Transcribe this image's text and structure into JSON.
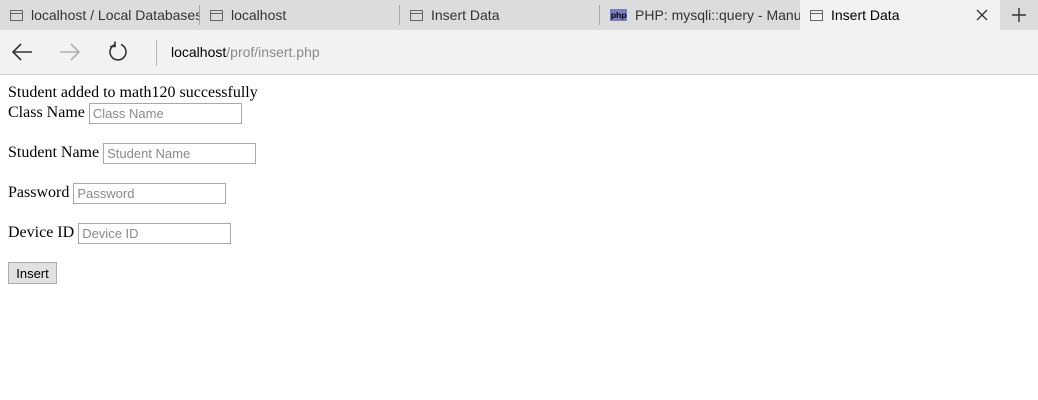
{
  "browser": {
    "tabs": [
      {
        "label": "localhost / Local Databases",
        "icon": "page-icon"
      },
      {
        "label": "localhost",
        "icon": "page-icon"
      },
      {
        "label": "Insert Data",
        "icon": "page-icon"
      },
      {
        "label": "PHP: mysqli::query - Manua",
        "icon": "php-icon",
        "icon_text": "php"
      },
      {
        "label": "Insert Data",
        "icon": "page-icon",
        "active": true
      }
    ],
    "address_host": "localhost",
    "address_path": "/prof/insert.php"
  },
  "page": {
    "message": "Student added to math120 successfully",
    "fields": {
      "class_name": {
        "label": "Class Name",
        "placeholder": "Class Name",
        "value": ""
      },
      "student_name": {
        "label": "Student Name",
        "placeholder": "Student Name",
        "value": ""
      },
      "password": {
        "label": "Password",
        "placeholder": "Password",
        "value": ""
      },
      "device_id": {
        "label": "Device ID",
        "placeholder": "Device ID",
        "value": ""
      }
    },
    "submit_label": "Insert"
  },
  "colors": {
    "tabstrip_bg": "#dcdcdc",
    "active_tab_bg": "#f2f2f2",
    "php_icon_bg": "#7a7fb5"
  }
}
